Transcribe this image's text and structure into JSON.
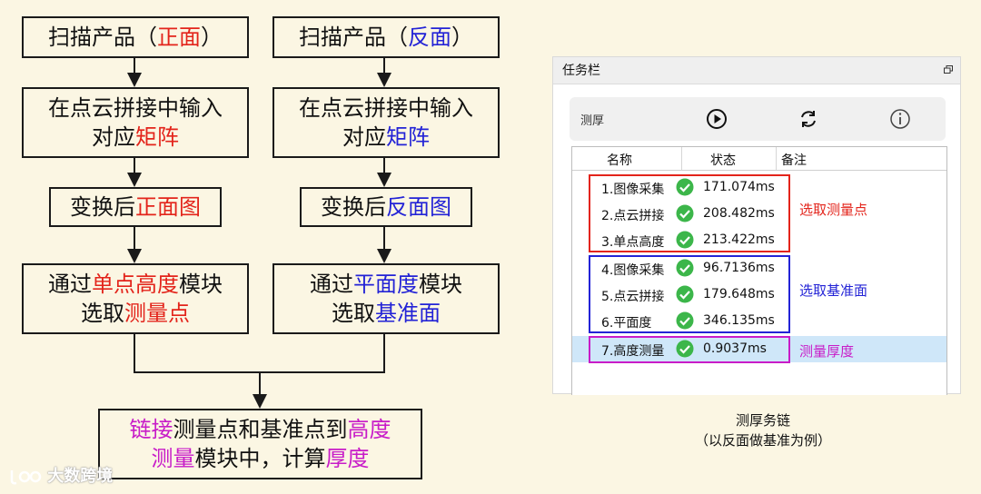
{
  "flow": {
    "left": {
      "scan": [
        "扫描产品（",
        "正面",
        "）"
      ],
      "stitch": [
        "在点云拼接中输入",
        "对应",
        "矩阵"
      ],
      "transform": [
        "变换后",
        "正面图"
      ],
      "select": [
        "通过",
        "单点高度",
        "模块",
        "选取",
        "测量点"
      ]
    },
    "right": {
      "scan": [
        "扫描产品（",
        "反面",
        "）"
      ],
      "stitch": [
        "在点云拼接中输入",
        "对应",
        "矩阵"
      ],
      "transform": [
        "变换后",
        "反面图"
      ],
      "select": [
        "通过",
        "平面度",
        "模块",
        "选取",
        "基准面"
      ]
    },
    "final": [
      "链接",
      "测量点和基准点到",
      "高度",
      "测量",
      "模块中，计算",
      "厚度"
    ]
  },
  "panel": {
    "title": "任务栏",
    "toolbar_label": "测厚",
    "columns": [
      "名称",
      "状态",
      "备注"
    ],
    "rows": [
      {
        "name": "1.图像采集",
        "time": "171.074ms"
      },
      {
        "name": "2.点云拼接",
        "time": "208.482ms"
      },
      {
        "name": "3.单点高度",
        "time": "213.422ms"
      },
      {
        "name": "4.图像采集",
        "time": "96.7136ms"
      },
      {
        "name": "5.点云拼接",
        "time": "179.648ms"
      },
      {
        "name": "6.平面度",
        "time": "346.135ms"
      },
      {
        "name": "7.高度测量",
        "time": "0.9037ms"
      }
    ],
    "group_labels": [
      "选取测量点",
      "选取基准面",
      "测量厚度"
    ],
    "colors": {
      "red": "#e3241b",
      "blue": "#2323d6",
      "magenta": "#c81cc8",
      "ok_green": "#3cb64a",
      "selected_row": "#cfe7f9"
    }
  },
  "caption": {
    "line1": "测厚务链",
    "line2": "（以反面做基准为例）"
  },
  "watermark": "大数跨境"
}
